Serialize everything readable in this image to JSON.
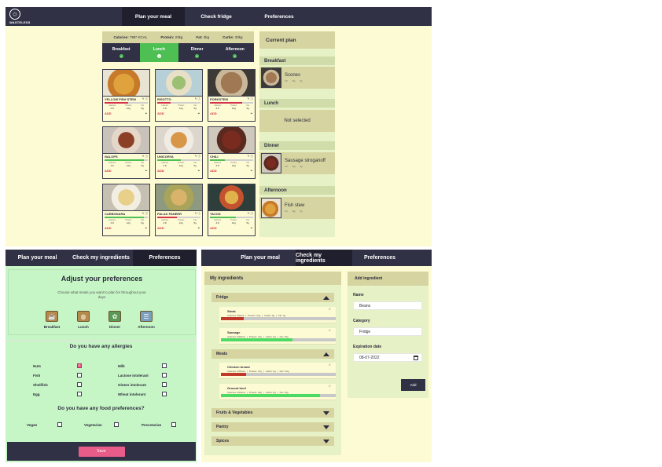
{
  "app": {
    "logo_text": "WASTELESS"
  },
  "panel1": {
    "nav": [
      "Plan your meal",
      "Check fridge",
      "Preferences"
    ],
    "macros": [
      {
        "label": "Calories:",
        "value": "798* KCAL"
      },
      {
        "label": "Protein:",
        "value": "23kg"
      },
      {
        "label": "Fat:",
        "value": "3kg"
      },
      {
        "label": "Carbs:",
        "value": "33kg"
      }
    ],
    "meals": [
      "Breakfast",
      "Lunch",
      "Dinner",
      "Afternoon"
    ],
    "active_meal": "Lunch",
    "recipes": [
      {
        "name": "YELLOW FISH STEW",
        "img": "curry",
        "fill": 0.55,
        "color": "#d6304b"
      },
      {
        "name": "RISOTTO",
        "img": "risotto",
        "fill": 0.3,
        "color": "#d6304b"
      },
      {
        "name": "PORKSTEW",
        "img": "pork",
        "fill": 0.75,
        "color": "#d6304b"
      },
      {
        "name": "NALOPS",
        "img": "nalops",
        "fill": 0.9,
        "color": "#4dbf53"
      },
      {
        "name": "UNICORYA",
        "img": "unicorn",
        "fill": 0.55,
        "color": "#4dbf53"
      },
      {
        "name": "CHILI",
        "img": "chili",
        "fill": 0.35,
        "color": "#4dbf53"
      },
      {
        "name": "CARBONARA",
        "img": "carbonara",
        "fill": 0.9,
        "color": "#4dbf53"
      },
      {
        "name": "PALAK PANEER",
        "img": "palak",
        "fill": 0.45,
        "color": "#d6304b"
      },
      {
        "name": "TACOS",
        "img": "tacos",
        "fill": 0.6,
        "color": "#4dbf53"
      }
    ],
    "recipe_stats": [
      "Calories",
      "Protein",
      "Fat"
    ],
    "recipe_values": [
      "4.8",
      "12g",
      "5g"
    ],
    "add_label": "ADD",
    "plan": {
      "title": "Current plan",
      "breakfast": {
        "label": "Breakfast",
        "item": "Scones"
      },
      "lunch": {
        "label": "Lunch",
        "item": "Not selected"
      },
      "dinner": {
        "label": "Dinner",
        "item": "Sausage stroganoff"
      },
      "afternoon": {
        "label": "Afternoon",
        "item": "Fish stew"
      },
      "macro_labels": [
        "Calories",
        "Protein",
        "Fat"
      ],
      "macro_values": [
        "4.8",
        "12g",
        "5g"
      ]
    }
  },
  "panel2": {
    "nav": [
      "Plan your meal",
      "Check my ingredients",
      "Preferences"
    ],
    "title": "Adjust your preferences",
    "subtitle": "Choose what meals you want to plan for throughout your days",
    "meals": [
      "Breakfast",
      "Lunch",
      "Dinner",
      "Afternoon"
    ],
    "allergy_title": "Do you have any allergies",
    "allergies": [
      {
        "label": "Nuts",
        "checked": true
      },
      {
        "label": "Milk",
        "checked": false
      },
      {
        "label": "Fish",
        "checked": false
      },
      {
        "label": "Lactose intolerant",
        "checked": false
      },
      {
        "label": "Shellfish",
        "checked": false
      },
      {
        "label": "Gluten intolerant",
        "checked": false
      },
      {
        "label": "Egg",
        "checked": false
      },
      {
        "label": "Wheat intolerant",
        "checked": false
      }
    ],
    "food_title": "Do you have any food preferences?",
    "foods": [
      {
        "label": "Vegan",
        "checked": false
      },
      {
        "label": "Vegetarian",
        "checked": false
      },
      {
        "label": "Pescetarian",
        "checked": false
      }
    ],
    "save_label": "Save",
    "colors": {
      "accent": "#e85c8a"
    }
  },
  "panel3": {
    "nav": [
      "Plan your meal",
      "Check my ingredients",
      "Preferences"
    ],
    "my_ingredients": "My ingredients",
    "categories": {
      "fridge": "Fridge",
      "meats": "Meats",
      "fruits": "Fruits & Vegetables",
      "pantry": "Pantry",
      "spices": "Spices"
    },
    "items": [
      {
        "name": "Steak",
        "macros": [
          "Calories: 56kCa",
          "Protein: 21g",
          "Carbs: 0g",
          "Fat: 4g"
        ],
        "fill": 0.2,
        "color": "#c0392b"
      },
      {
        "name": "Sausage",
        "macros": [
          "Calories: 301kCa",
          "Protein: 27g",
          "Carbs: 3g",
          "Fat: 15g"
        ],
        "fill": 0.62,
        "color": "#4cd964"
      },
      {
        "name": "Chicken breast",
        "macros": [
          "Calories: 301kCa",
          "Protein: 27g",
          "Carbs: 0g",
          "Fat: 3.6g"
        ],
        "fill": 0.22,
        "color": "#c0392b"
      },
      {
        "name": "Ground beef",
        "macros": [
          "Calories: 301kCa",
          "Protein: 26g",
          "Carbs: 0g",
          "Fat: 15g"
        ],
        "fill": 0.86,
        "color": "#4cd964"
      }
    ],
    "add": {
      "title": "Add ingredient",
      "name_label": "Name",
      "name_value": "Beans",
      "category_label": "Category",
      "category_value": "Fridge",
      "date_label": "Expiration date",
      "date_value": "08-07-2022",
      "button": "Add"
    }
  }
}
